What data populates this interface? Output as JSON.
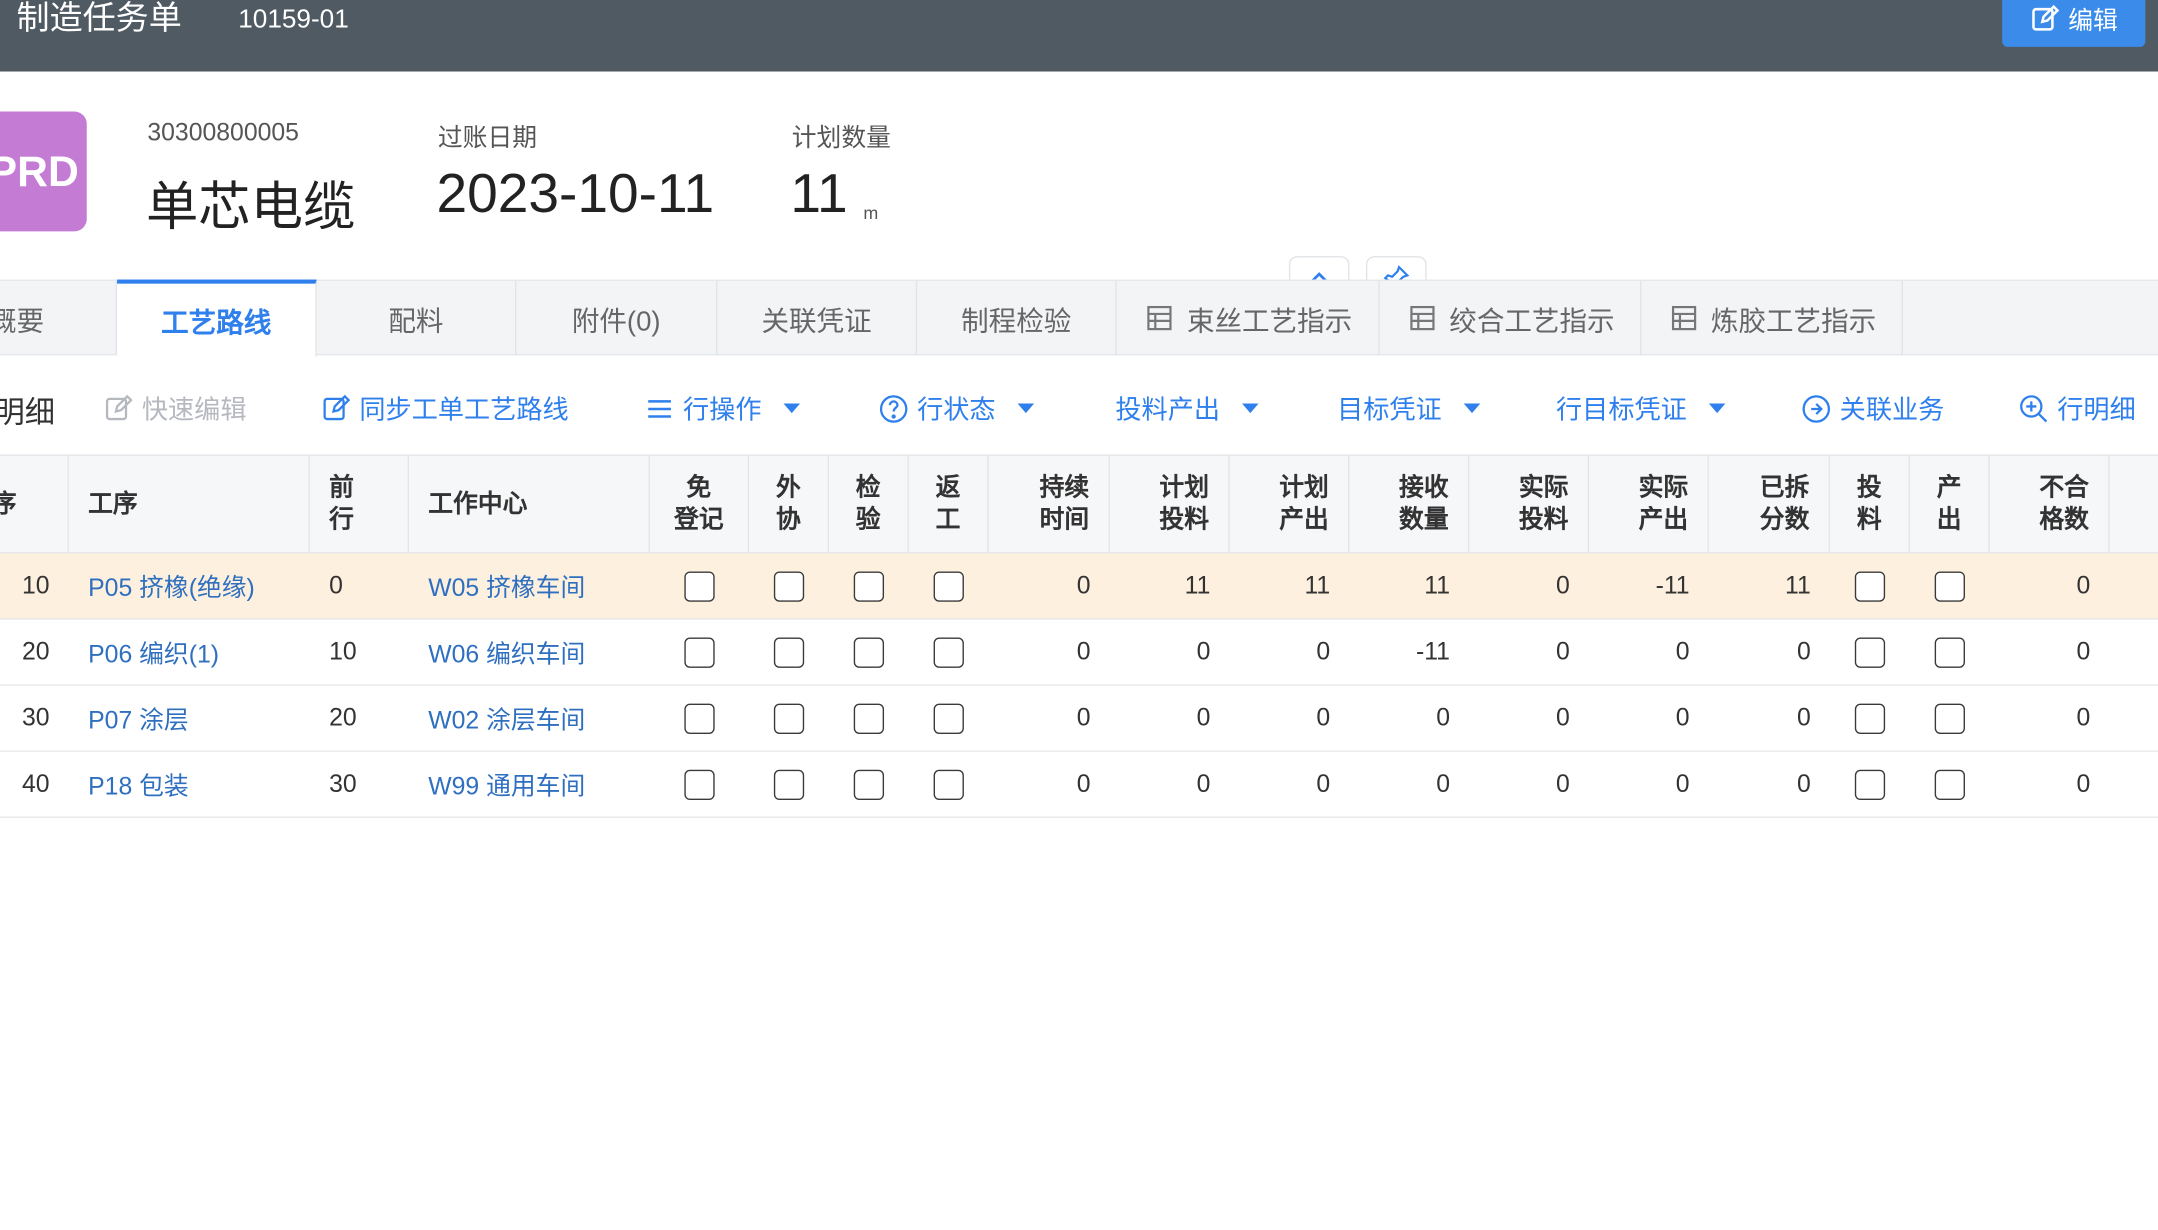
{
  "header": {
    "title": "制造任务单",
    "doc_no": "10159-01",
    "edit_label": "编辑"
  },
  "summary": {
    "badge": "PRD",
    "code": "30300800005",
    "name": "单芯电缆",
    "post_date_label": "过账日期",
    "post_date": "2023-10-11",
    "plan_qty_label": "计划数量",
    "plan_qty": "11",
    "plan_qty_unit": "m"
  },
  "tabs": [
    {
      "label": "概要"
    },
    {
      "label": "工艺路线"
    },
    {
      "label": "配料"
    },
    {
      "label": "附件(0)"
    },
    {
      "label": "关联凭证"
    },
    {
      "label": "制程检验"
    },
    {
      "label": "束丝工艺指示"
    },
    {
      "label": "绞合工艺指示"
    },
    {
      "label": "炼胶工艺指示"
    }
  ],
  "toolbar": {
    "title": "明细",
    "quick_edit": "快速编辑",
    "sync_route": "同步工单工艺路线",
    "row_ops": "行操作",
    "row_status": "行状态",
    "feed_output": "投料产出",
    "target_voucher": "目标凭证",
    "row_target_voucher": "行目标凭证",
    "related_business": "关联业务",
    "row_detail": "行明细"
  },
  "table": {
    "headers": {
      "seq": "序",
      "process": "工序",
      "prev": "前\n行",
      "center": "工作中心",
      "no_reg": "免\n登记",
      "outsource": "外\n协",
      "inspect": "检\n验",
      "rework": "返\n工",
      "duration": "持续\n时间",
      "plan_feed": "计划\n投料",
      "plan_output": "计划\n产出",
      "recv_qty": "接收\n数量",
      "act_feed": "实际\n投料",
      "act_output": "实际\n产出",
      "split": "已拆\n分数",
      "feed": "投\n料",
      "output": "产\n出",
      "unqualified": "不合\n格数"
    },
    "rows": [
      {
        "seq": "10",
        "process": "P05 挤橡(绝缘)",
        "prev": "0",
        "center": "W05 挤橡车间",
        "duration": "0",
        "plan_feed": "11",
        "plan_output": "11",
        "recv_qty": "11",
        "act_feed": "0",
        "act_output": "-11",
        "split": "11",
        "unqualified": "0"
      },
      {
        "seq": "20",
        "process": "P06 编织(1)",
        "prev": "10",
        "center": "W06 编织车间",
        "duration": "0",
        "plan_feed": "0",
        "plan_output": "0",
        "recv_qty": "-11",
        "act_feed": "0",
        "act_output": "0",
        "split": "0",
        "unqualified": "0"
      },
      {
        "seq": "30",
        "process": "P07 涂层",
        "prev": "20",
        "center": "W02 涂层车间",
        "duration": "0",
        "plan_feed": "0",
        "plan_output": "0",
        "recv_qty": "0",
        "act_feed": "0",
        "act_output": "0",
        "split": "0",
        "unqualified": "0"
      },
      {
        "seq": "40",
        "process": "P18 包装",
        "prev": "30",
        "center": "W99 通用车间",
        "duration": "0",
        "plan_feed": "0",
        "plan_output": "0",
        "recv_qty": "0",
        "act_feed": "0",
        "act_output": "0",
        "split": "0",
        "unqualified": "0"
      }
    ]
  },
  "colors": {
    "header_bg": "#4f5a63",
    "accent": "#2f80ed",
    "badge": "#c47bd4",
    "selected_row": "#fdf0de"
  },
  "icons": [
    "edit-icon",
    "pin-icon",
    "collapse-icon",
    "grid-doc-icon",
    "list-icon",
    "help-circle-icon",
    "arrow-circle-icon",
    "zoom-plus-icon"
  ]
}
